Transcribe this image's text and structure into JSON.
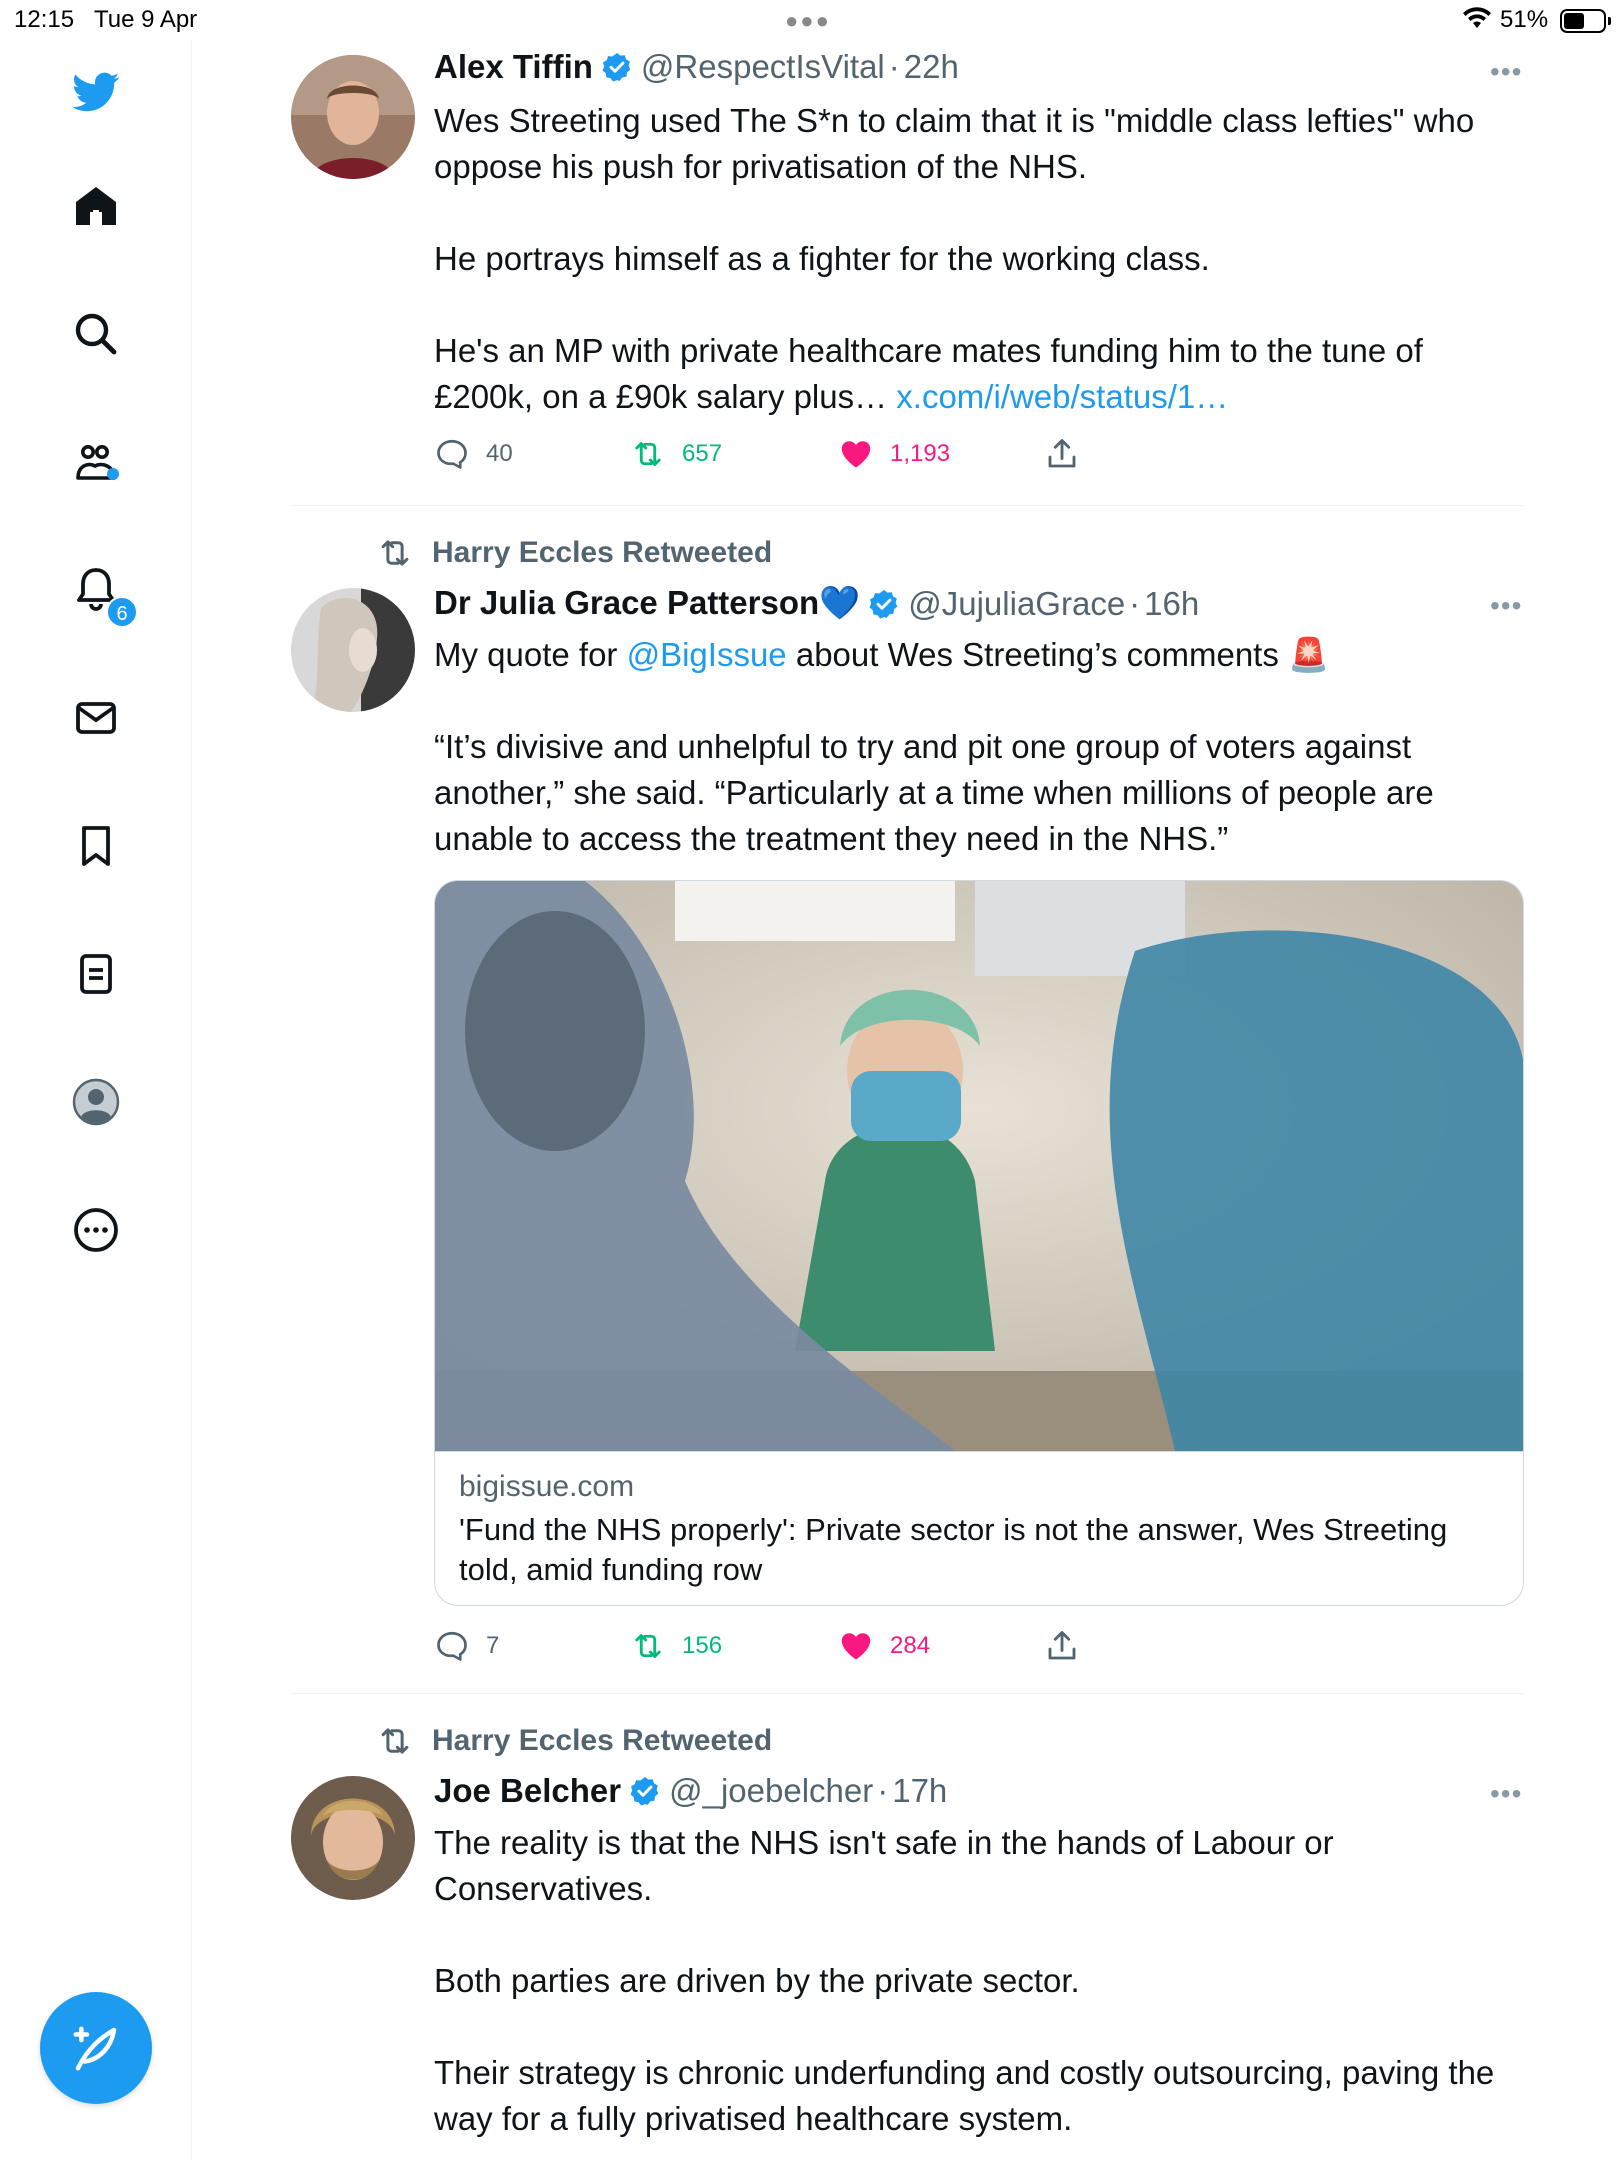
{
  "status_bar": {
    "time": "12:15",
    "date": "Tue 9 Apr",
    "battery": "51%"
  },
  "sidebar": {
    "notifications_badge": "6",
    "items": [
      {
        "icon": "twitter-bird-icon"
      },
      {
        "icon": "home-icon"
      },
      {
        "icon": "search-icon"
      },
      {
        "icon": "communities-icon"
      },
      {
        "icon": "notifications-bell-icon"
      },
      {
        "icon": "messages-envelope-icon"
      },
      {
        "icon": "bookmark-icon"
      },
      {
        "icon": "lists-icon"
      },
      {
        "icon": "profile-icon"
      },
      {
        "icon": "more-circle-icon"
      }
    ],
    "compose_icon": "compose-feather-icon"
  },
  "tweets": [
    {
      "name": "Alex Tiffin",
      "handle": "@RespectIsVital",
      "sep": "·",
      "time": "22h",
      "text": "Wes Streeting used The S*n to claim that it is \"middle class lefties\" who oppose his push for privatisation of the NHS.\n\nHe portrays himself as a fighter for the working class.\n\nHe's an MP with private healthcare mates funding him to the tune of £200k, on a £90k salary plus… ",
      "link": "x.com/i/web/status/1…",
      "replies": "40",
      "retweets": "657",
      "likes": "1,193"
    },
    {
      "retweeted_by": "Harry Eccles Retweeted",
      "name": "Dr Julia Grace Patterson💙",
      "handle": "@JujuliaGrace",
      "sep": "·",
      "time": "16h",
      "text_before": "My quote for ",
      "mention": "@BigIssue",
      "text_after": " about Wes Streeting’s comments 🚨\n\n“It’s divisive and unhelpful to try and pit one group of voters against another,” she said. “Particularly at a time when millions of people are unable to access the treatment they need in the NHS.”",
      "card": {
        "domain": "bigissue.com",
        "title": "'Fund the NHS properly': Private sector is not the answer, Wes Streeting told, amid funding row"
      },
      "replies": "7",
      "retweets": "156",
      "likes": "284"
    },
    {
      "retweeted_by": "Harry Eccles Retweeted",
      "name": "Joe Belcher",
      "handle": "@_joebelcher",
      "sep": "·",
      "time": "17h",
      "text": "The reality is that the NHS isn't safe in the hands of Labour or Conservatives.\n\nBoth parties are driven by the private sector.\n\nTheir strategy is chronic underfunding and costly outsourcing, paving the way for a fully privatised healthcare system."
    }
  ],
  "more_label": "•••",
  "colors": {
    "accent": "#1d9bf0",
    "retweet": "#00ba7c",
    "like": "#f91880",
    "secondary": "#536471"
  }
}
